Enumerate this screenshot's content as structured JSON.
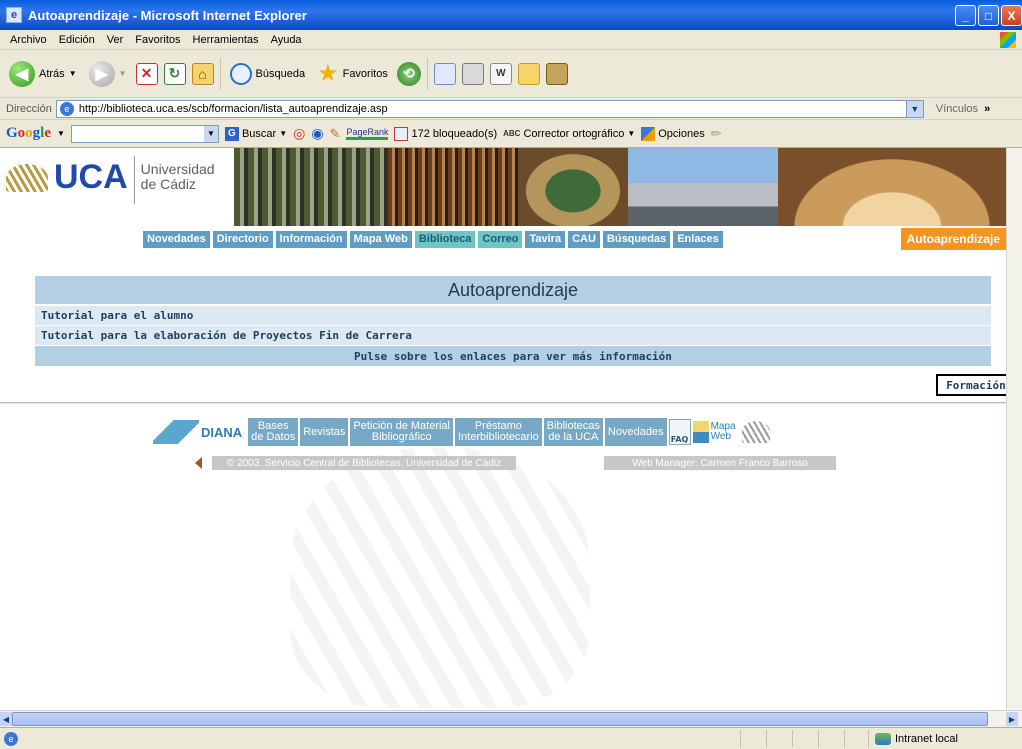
{
  "window": {
    "title": "Autoaprendizaje - Microsoft Internet Explorer",
    "buttons": {
      "minimize": "_",
      "maximize": "□",
      "close": "X"
    }
  },
  "menubar": [
    "Archivo",
    "Edición",
    "Ver",
    "Favoritos",
    "Herramientas",
    "Ayuda"
  ],
  "toolbar": {
    "back": "Atrás",
    "search": "Búsqueda",
    "favorites": "Favoritos"
  },
  "address": {
    "label": "Dirección",
    "url": "http://biblioteca.uca.es/scb/formacion/lista_autoaprendizaje.asp",
    "links_label": "Vínculos",
    "links_more": "»"
  },
  "google_toolbar": {
    "logo": [
      "G",
      "o",
      "o",
      "g",
      "l",
      "e"
    ],
    "search_label": "Buscar",
    "pagerank_label": "PageRank",
    "blocked": "172 bloqueado(s)",
    "spellcheck": "Corrector ortográfico",
    "options": "Opciones"
  },
  "site": {
    "logo_text": "UCA",
    "university_name_line1": "Universidad",
    "university_name_line2": "de Cádiz",
    "nav": [
      "Novedades",
      "Directorio",
      "Información",
      "Mapa Web",
      "Biblioteca",
      "Correo",
      "Tavira",
      "CAU",
      "Búsquedas",
      "Enlaces"
    ],
    "nav_active_index": 4,
    "section_tag": "Autoaprendizaje"
  },
  "content": {
    "title": "Autoaprendizaje",
    "links": [
      "Tutorial para el alumno",
      "Tutorial para la elaboración de Proyectos Fin de Carrera"
    ],
    "info": "Pulse sobre los enlaces para ver más información",
    "formacion_button": "Formación"
  },
  "footer": {
    "diana": "DIANA",
    "links": [
      "Bases\nde Datos",
      "Revistas",
      "Petición de Material\nBibliográfico",
      "Préstamo\nInterbibliotecario",
      "Bibliotecas\nde la UCA",
      "Novedades"
    ],
    "faq": "FAQ",
    "mapa_line1": "Mapa",
    "mapa_line2": "Web",
    "copyright": "© 2003. Servicio Central de Bibliotecas. Universidad de Cádiz",
    "webmanager": "Web Manager: Carmen Franco Barroso"
  },
  "statusbar": {
    "zone": "Intranet local"
  },
  "colors": {
    "nav_bg": "#5e9ec6",
    "nav_active_bg": "#6fc4c4",
    "section_tag_bg": "#f7941d",
    "title_row_bg": "#b4cfe4",
    "link_row_bg": "#dce8f2",
    "footer_link_bg": "#77a9c6"
  }
}
